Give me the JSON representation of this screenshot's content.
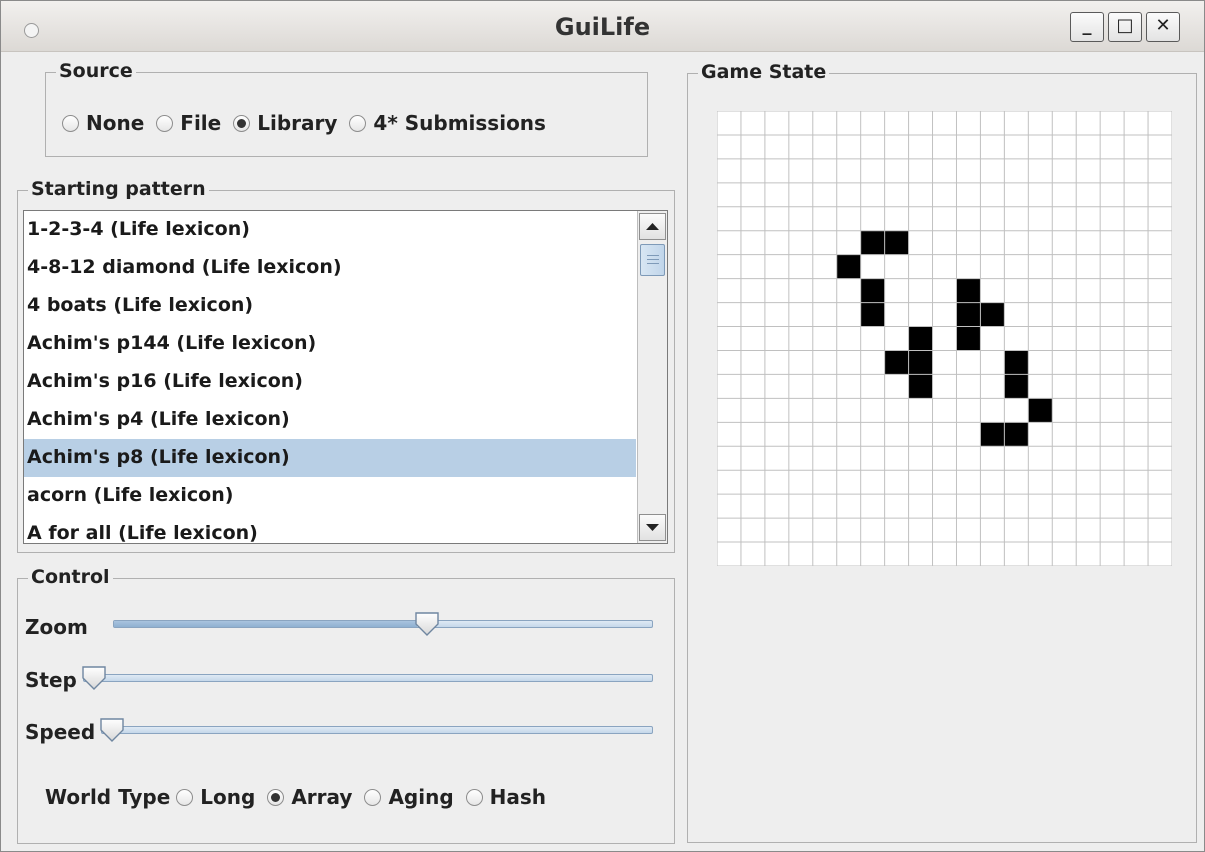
{
  "window": {
    "title": "GuiLife",
    "buttons": {
      "minimize": "_",
      "maximize": "□",
      "close": "✕"
    }
  },
  "source": {
    "legend": "Source",
    "options": [
      "None",
      "File",
      "Library",
      "4* Submissions"
    ],
    "selected": "Library"
  },
  "starting_pattern": {
    "legend": "Starting pattern",
    "items": [
      "1-2-3-4 (Life lexicon)",
      "4-8-12 diamond (Life lexicon)",
      "4 boats (Life lexicon)",
      "Achim's p144 (Life lexicon)",
      "Achim's p16 (Life lexicon)",
      "Achim's p4 (Life lexicon)",
      "Achim's p8 (Life lexicon)",
      "acorn (Life lexicon)",
      "A for all (Life lexicon)"
    ],
    "selected_index": 6,
    "scroll_position": 0.03
  },
  "control": {
    "legend": "Control",
    "zoom_label": "Zoom",
    "step_label": "Step",
    "speed_label": "Speed",
    "zoom_value": 0.59,
    "step_value": 0.0,
    "speed_value": 0.0,
    "world_type_label": "World Type",
    "world_types": [
      "Long",
      "Array",
      "Aging",
      "Hash"
    ],
    "world_type_selected": "Array"
  },
  "game_state": {
    "legend": "Game State",
    "cols": 19,
    "rows": 19,
    "live_cells": [
      [
        6,
        5
      ],
      [
        7,
        5
      ],
      [
        5,
        6
      ],
      [
        6,
        7
      ],
      [
        10,
        7
      ],
      [
        6,
        8
      ],
      [
        10,
        8
      ],
      [
        11,
        8
      ],
      [
        8,
        9
      ],
      [
        10,
        9
      ],
      [
        7,
        10
      ],
      [
        8,
        10
      ],
      [
        12,
        10
      ],
      [
        8,
        11
      ],
      [
        12,
        11
      ],
      [
        13,
        12
      ],
      [
        11,
        13
      ],
      [
        12,
        13
      ]
    ],
    "colors": {
      "alive": "#000000",
      "dead": "#ffffff",
      "grid": "#c0c0c0"
    }
  }
}
